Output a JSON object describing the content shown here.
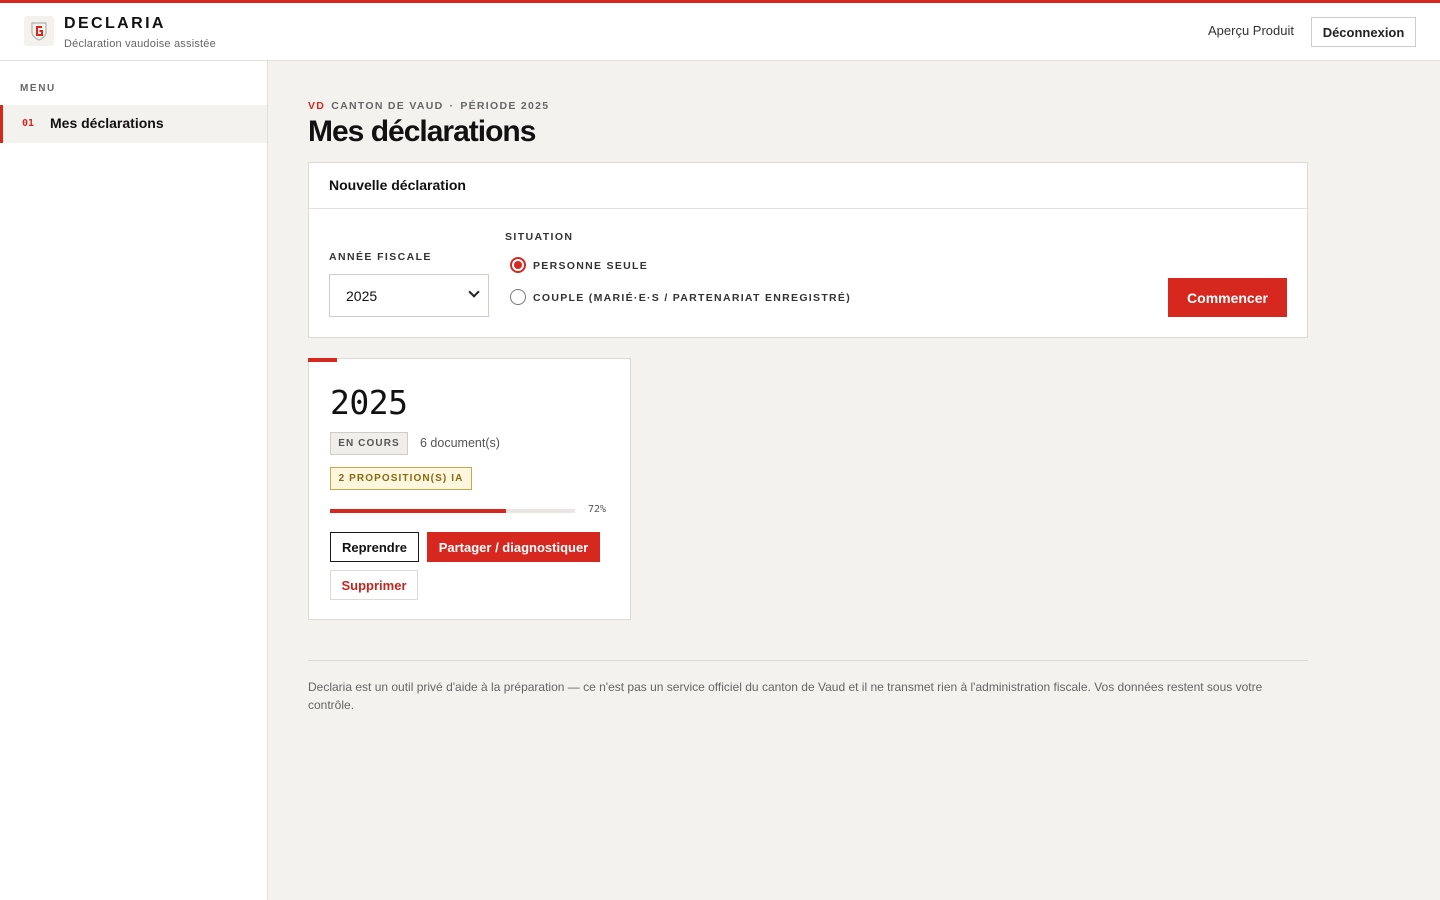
{
  "colors": {
    "accent": "#d6281f",
    "background": "#f3f2ef",
    "ai_badge": "#fdf7e0"
  },
  "header": {
    "logo_icon": "shield-g-logo",
    "brand_name": "DECLARIA",
    "brand_subtitle": "Déclaration vaudoise assistée",
    "preview_link": "Aperçu Produit",
    "logout_label": "Déconnexion"
  },
  "sidebar": {
    "menu_label": "MENU",
    "items": [
      {
        "number": "01",
        "label": "Mes déclarations",
        "active": true
      }
    ]
  },
  "page": {
    "canton_code": "VD",
    "canton_label": "CANTON DE VAUD",
    "separator": "·",
    "period_label": "PÉRIODE 2025",
    "title": "Mes déclarations"
  },
  "new_declaration": {
    "heading": "Nouvelle déclaration",
    "year_label": "ANNÉE FISCALE",
    "year_value": "2025",
    "situation_label": "SITUATION",
    "options": [
      {
        "label": "PERSONNE SEULE",
        "checked": true
      },
      {
        "label": "COUPLE (MARIÉ·E·S / PARTENARIAT ENREGISTRÉ)",
        "checked": false
      }
    ],
    "start_label": "Commencer"
  },
  "declarations": [
    {
      "year": "2025",
      "status": "EN COURS",
      "documents": "6 document(s)",
      "ai_badge": "2 PROPOSITION(S) IA",
      "progress": 0.72,
      "progress_label": "72%",
      "resume_label": "Reprendre",
      "share_label": "Partager / diagnostiquer",
      "delete_label": "Supprimer"
    }
  ],
  "footer": {
    "note": "Declaria est un outil privé d'aide à la préparation — ce n'est pas un service officiel du canton de Vaud et il ne transmet rien à l'administration fiscale. Vos données restent sous votre contrôle."
  }
}
